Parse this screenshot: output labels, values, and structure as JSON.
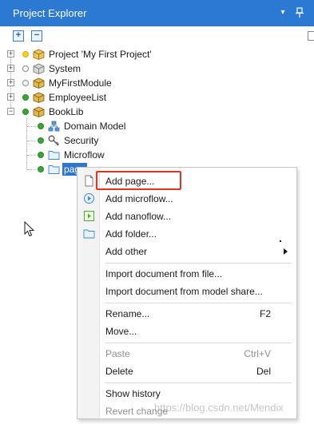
{
  "window": {
    "title": "Project Explorer",
    "dropdown_glyph": "▾",
    "pin_glyph": "⊥"
  },
  "toolbar": {
    "expand_all_glyph": "+",
    "collapse_all_glyph": "−"
  },
  "tree": {
    "items": [
      {
        "label": "Project 'My First Project'",
        "status": "yellow",
        "icon": "project-box-icon"
      },
      {
        "label": "System",
        "status": "hollow",
        "icon": "module-box-icon"
      },
      {
        "label": "MyFirstModule",
        "status": "hollow",
        "icon": "module-box-icon"
      },
      {
        "label": "EmployeeList",
        "status": "green",
        "icon": "module-box-icon"
      },
      {
        "label": "BookLib",
        "status": "green",
        "icon": "module-box-icon"
      },
      {
        "label": "Domain Model",
        "status": "green",
        "icon": "domain-model-icon"
      },
      {
        "label": "Security",
        "status": "green",
        "icon": "key-icon"
      },
      {
        "label": "Microflow",
        "status": "green",
        "icon": "folder-icon"
      },
      {
        "label": "page",
        "status": "green",
        "icon": "folder-icon",
        "selected": true
      }
    ]
  },
  "context_menu": {
    "items": {
      "add_page": "Add page...",
      "add_microflow": "Add microflow...",
      "add_nanoflow": "Add nanoflow...",
      "add_folder": "Add folder...",
      "add_other": "Add other",
      "import_file": "Import document from file...",
      "import_share": "Import document from model share...",
      "rename": "Rename...",
      "rename_shortcut": "F2",
      "move": "Move...",
      "paste": "Paste",
      "paste_shortcut": "Ctrl+V",
      "delete": "Delete",
      "delete_shortcut": "Del",
      "show_history": "Show history",
      "revert_changes": "Revert change"
    },
    "highlight_color": "#e53322"
  },
  "watermark": "https://blog.csdn.net/Mendix",
  "colors": {
    "titlebar": "#2b79d1",
    "selection": "#2f77cc"
  }
}
